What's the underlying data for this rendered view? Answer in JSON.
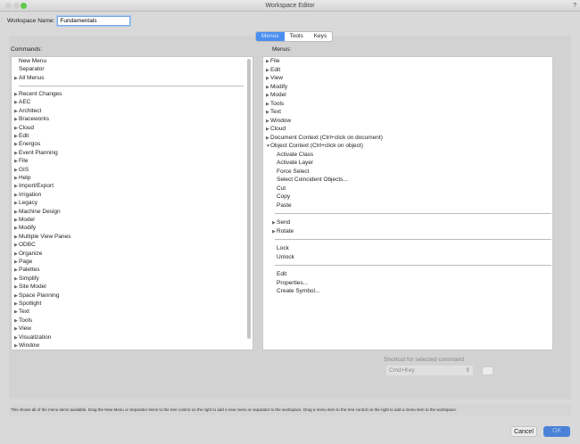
{
  "window": {
    "title": "Workspace Editor",
    "help": "?"
  },
  "workspace": {
    "label": "Workspace Name:",
    "value": "Fundamentals"
  },
  "tabs": [
    {
      "label": "Menus",
      "active": true
    },
    {
      "label": "Tools"
    },
    {
      "label": "Keys"
    }
  ],
  "commands": {
    "label": "Commands:",
    "top_items": [
      "New Menu",
      "Separator"
    ],
    "all_menus": "All Menus",
    "items": [
      "Recent Changes",
      "AEC",
      "Architect",
      "Braceworks",
      "Cloud",
      "Edit",
      "Energos",
      "Event Planning",
      "File",
      "GIS",
      "Help",
      "Import/Export",
      "Irrigation",
      "Legacy",
      "Machine Design",
      "Model",
      "Modify",
      "Multiple View Panes",
      "ODBC",
      "Organize",
      "Page",
      "Palettes",
      "Simplify",
      "Site Model",
      "Space Planning",
      "Spotlight",
      "Text",
      "Tools",
      "View",
      "Visualization",
      "Window"
    ]
  },
  "menus": {
    "label": "Menus:",
    "items": [
      "File",
      "Edit",
      "View",
      "Modify",
      "Model",
      "Tools",
      "Text",
      "Window",
      "Cloud",
      "Document Context (Ctrl+click on document)"
    ],
    "expanded": "Object Context (Ctrl+click on object)",
    "children": [
      {
        "label": "Activate Class"
      },
      {
        "label": "Activate Layer"
      },
      {
        "label": "Force Select"
      },
      {
        "label": "Select Coincident Objects..."
      },
      {
        "label": "Cut"
      },
      {
        "label": "Copy"
      },
      {
        "label": "Paste"
      },
      {
        "sep": true
      },
      {
        "label": "Send",
        "sub": true
      },
      {
        "label": "Rotate",
        "sub": true
      },
      {
        "sep": true
      },
      {
        "label": "Lock"
      },
      {
        "label": "Unlock"
      },
      {
        "sep": true
      },
      {
        "label": "Edit"
      },
      {
        "label": "Properties..."
      },
      {
        "label": "Create Symbol..."
      }
    ]
  },
  "shortcut": {
    "label": "Shortcut for selected command",
    "value": "Cmd+Key"
  },
  "help_text": "This shows all of the menu items available. Drag the New Menu or Separator items to the tree control on the right to add a new menu or separator to the workspace. Drag a menu item to the tree control on the right to add a menu item to the workspace.",
  "buttons": {
    "cancel": "Cancel",
    "ok": "OK"
  },
  "colors": {
    "accent": "#4a8ef0"
  }
}
